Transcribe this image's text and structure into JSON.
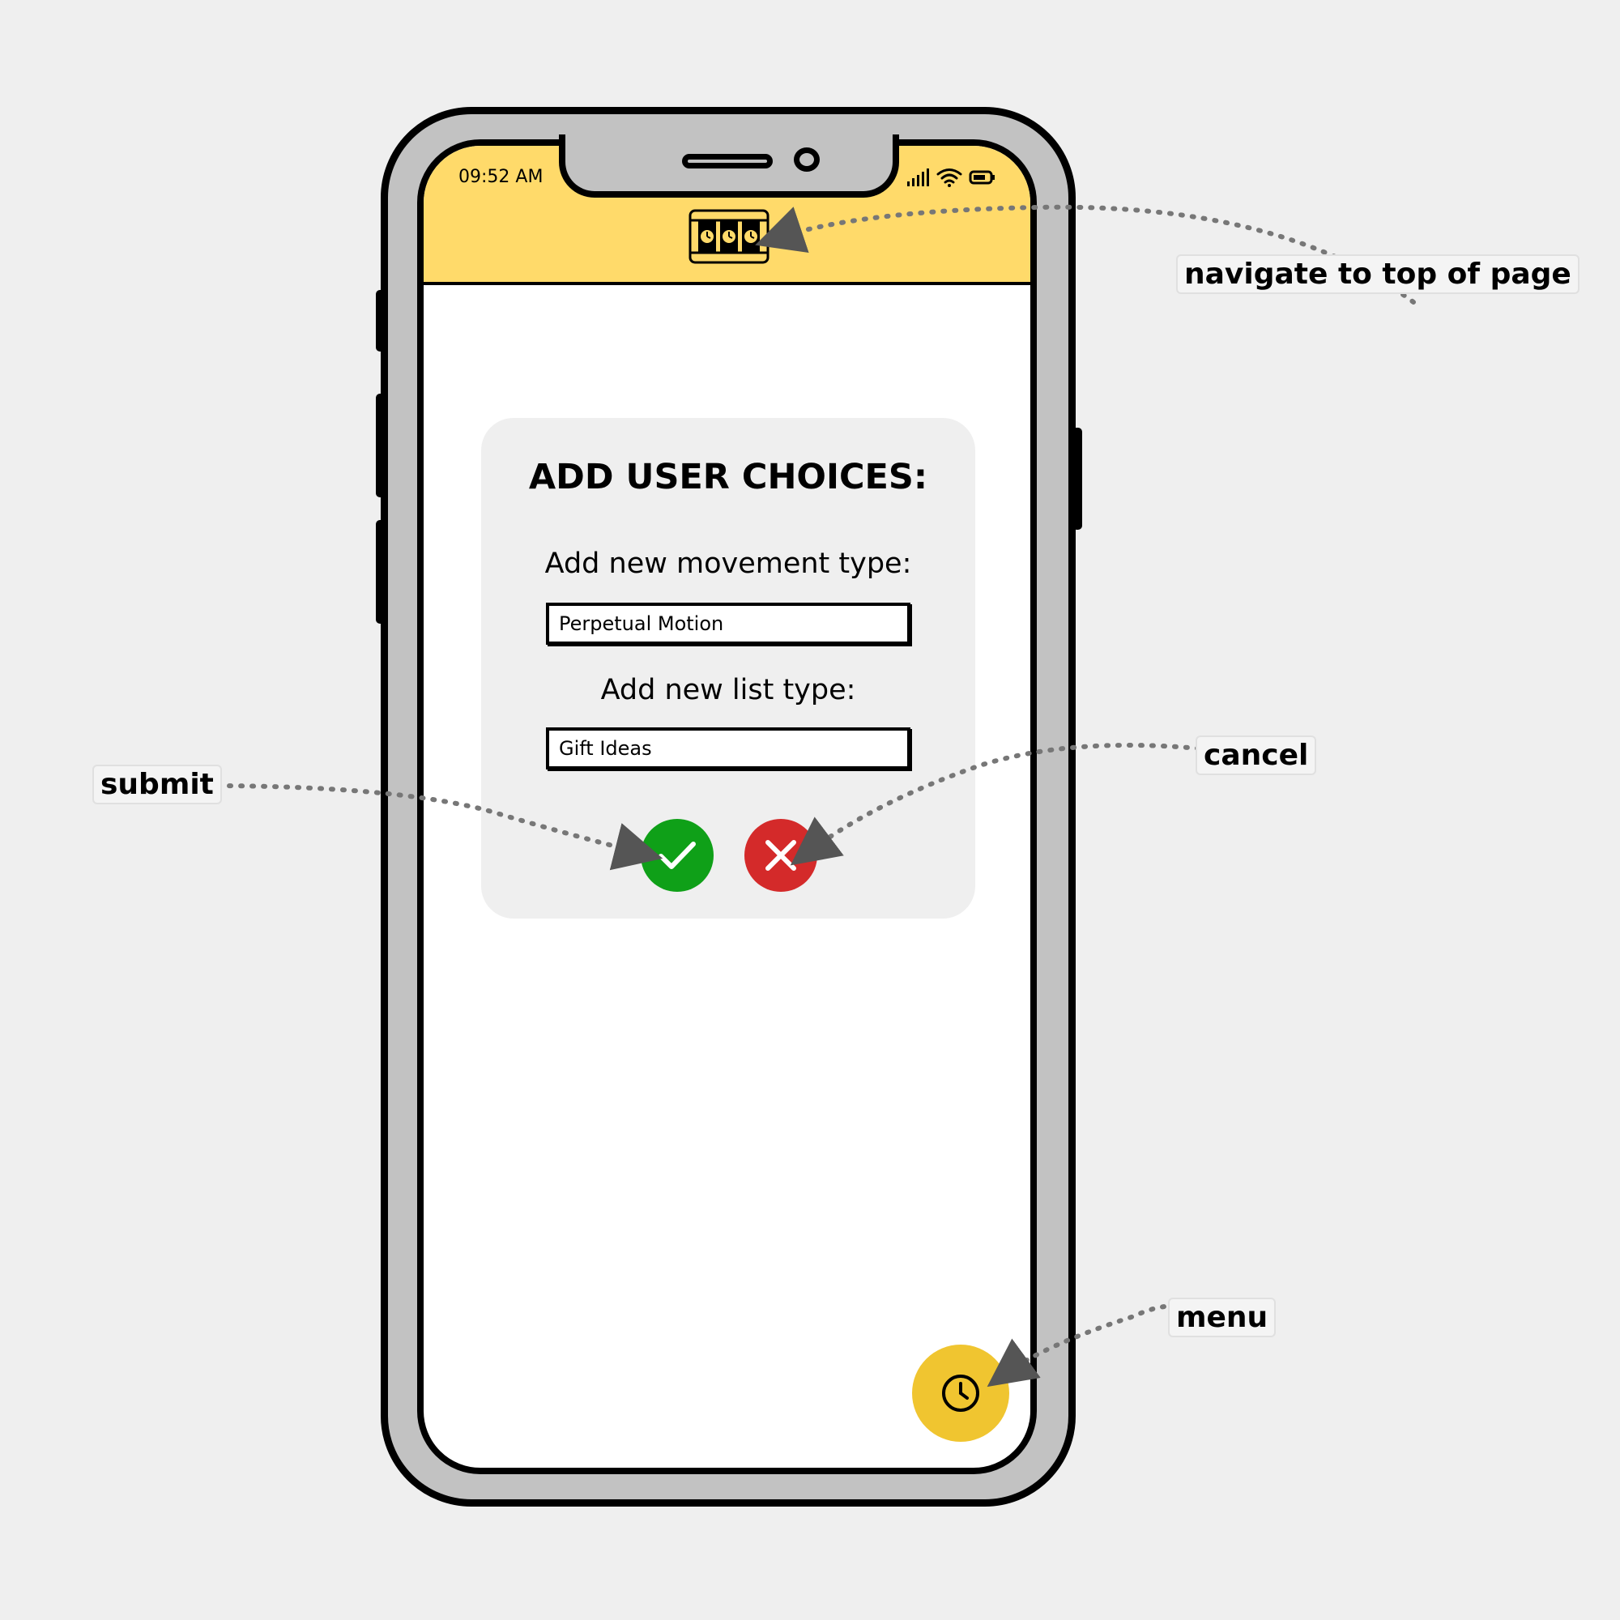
{
  "status_bar": {
    "time": "09:52 AM"
  },
  "header": {
    "logo_icon": "watches-icon"
  },
  "dialog": {
    "title": "ADD USER CHOICES:",
    "movement_label": "Add new movement type:",
    "movement_value": "Perpetual Motion",
    "list_label": "Add new list type:",
    "list_value": "Gift Ideas",
    "submit_icon": "check-icon",
    "cancel_icon": "x-icon"
  },
  "fab": {
    "icon": "clock-icon"
  },
  "annotations": {
    "navigate_top": "navigate to top of page",
    "submit": "submit",
    "cancel": "cancel",
    "menu": "menu"
  },
  "colors": {
    "background": "#efefef",
    "phone_body": "#c2c2c2",
    "header": "#ffda6a",
    "submit": "#0fa018",
    "cancel": "#d42a2a",
    "fab": "#f0c530",
    "dialog": "#efefef"
  }
}
